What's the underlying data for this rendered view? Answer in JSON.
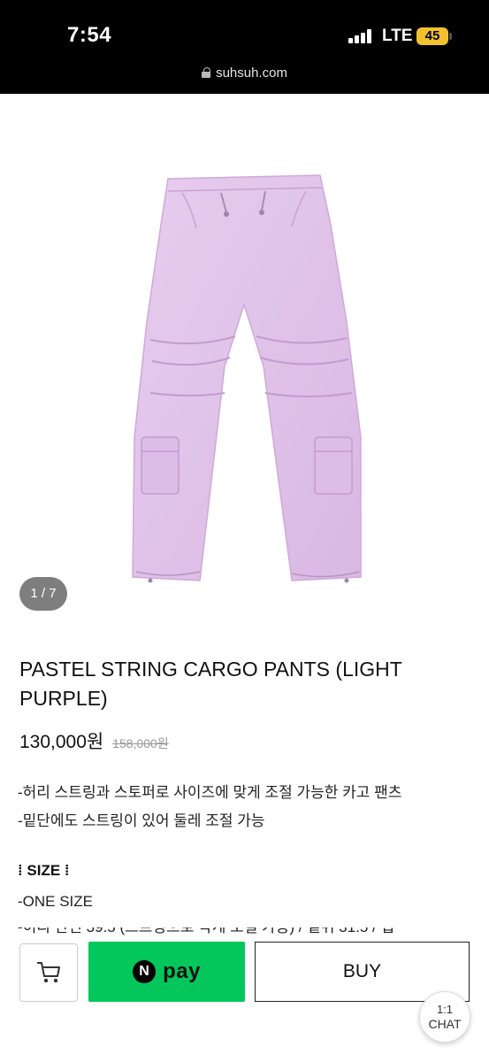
{
  "status_bar": {
    "time": "7:54",
    "network": "LTE",
    "battery": "45"
  },
  "browser": {
    "url": "suhsuh.com"
  },
  "gallery": {
    "counter": "1 / 7"
  },
  "product": {
    "title": "PASTEL STRING CARGO PANTS (LIGHT PURPLE)",
    "price": "130,000원",
    "original_price": "158,000원",
    "description": [
      "-허리 스트링과 스토퍼로 사이즈에 맞게 조절 가능한 카고 팬츠",
      "-밑단에도 스트링이 있어 둘레 조절 가능"
    ],
    "size_heading": "⁞ SIZE ⁞",
    "size_lines": [
      "-ONE SIZE",
      "-허리 단면 39.5 (스트링으로 작게 조절 가능) / 밑위 31.5 / 힙"
    ]
  },
  "actions": {
    "cart_icon": "cart-icon",
    "npay_n": "N",
    "npay_label": "pay",
    "buy_label": "BUY",
    "chat_line1": "1:1",
    "chat_line2": "CHAT"
  },
  "colors": {
    "npay_green": "#03c75a",
    "pants_lavender": "#e3c6ec",
    "battery_yellow": "#f2c12e"
  }
}
